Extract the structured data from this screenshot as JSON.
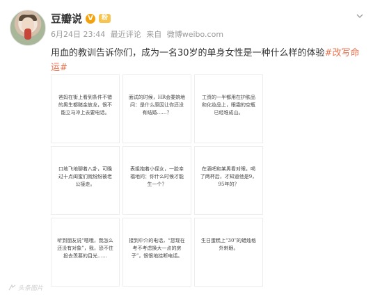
{
  "post": {
    "username": "豆瓣说",
    "verified_badge": "V",
    "level_badge": "粉",
    "time": "6月24日 23:44",
    "source_prefix": "最近评论",
    "source_label": "来自",
    "source": "微博weibo.com",
    "text_main": "用血的教训告诉你们，成为一名30岁的单身女性是一种什么样的体验",
    "hashtag": "#改写命运#"
  },
  "images": [
    {
      "text": "爸妈在街上看到条件不错的男生都赌金放龙，恨不能立马冲上去要电话。"
    },
    {
      "text": "面试的时候，HR会委婉地问：是什么原因让你还没有结婚……？"
    },
    {
      "text": "工资的一半都用在护肤品和化妆品上，眼霜的空瓶已经堆成山。"
    },
    {
      "text": "口地飞地聊着八卦，可晚过十点闺蜜们就纷纷被老公接走。"
    },
    {
      "text": "表姐抱着小侄女，一脸幸福地问：你什么时候才能生一个？"
    },
    {
      "text": "在酒吧和某男看对眼，喝了两杯后，才知道他是9，95年的？"
    },
    {
      "text": "听到朋友说“嗯哦，我怎么还没有对象”，我，恐不住投去羡慕的目光……"
    },
    {
      "text": "接到中介的电话，“您现在考不考虑换大一点的房子”，恨恨地挂断电话。"
    },
    {
      "text": "生日蛋糕上“30”的蜡烛格外刺眼。"
    }
  ],
  "watermark": "头条图片",
  "colors": {
    "accent": "#eb7350",
    "meta": "#999999"
  },
  "icons": {
    "menu": "chevron-down-icon",
    "badge": "verified-icon"
  }
}
